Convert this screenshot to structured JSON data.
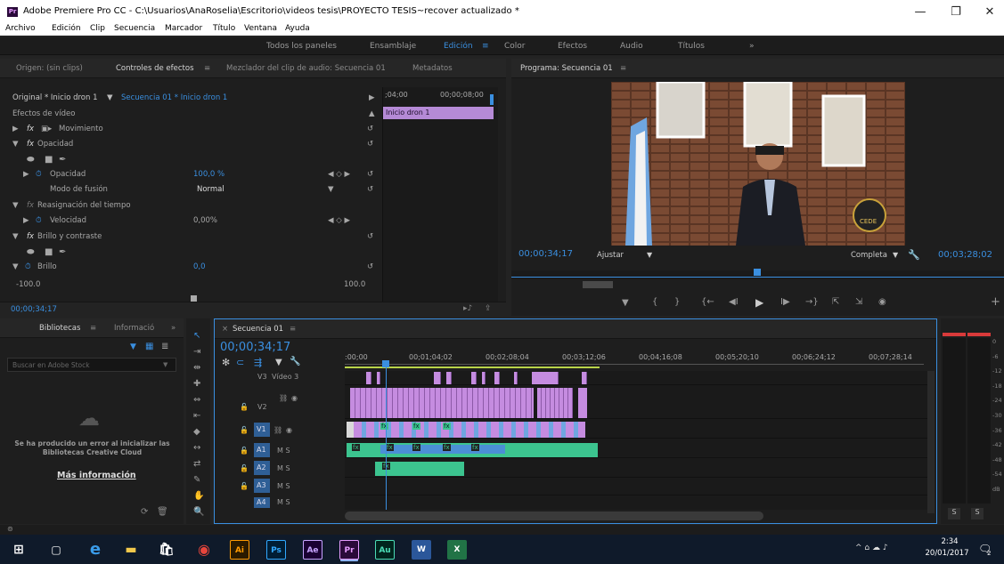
{
  "window": {
    "title": "Adobe Premiere Pro CC - C:\\Usuarios\\AnaRoselia\\Escritorio\\videos tesis\\PROYECTO TESIS~recover actualizado *",
    "app_icon": "Pr",
    "minimize": "—",
    "restore": "❐",
    "close": "✕"
  },
  "menu": [
    "Archivo",
    "Edición",
    "Clip",
    "Secuencia",
    "Marcador",
    "Título",
    "Ventana",
    "Ayuda"
  ],
  "workspaces": {
    "items": [
      "Todos los paneles",
      "Ensamblaje",
      "Edición",
      "Color",
      "Efectos",
      "Audio",
      "Títulos"
    ],
    "active": "Edición",
    "menu_glyph": "≡",
    "more": "»"
  },
  "source_panel": {
    "tabs": [
      "Origen: (sin clips)",
      "Controles de efectos",
      "Mezclador del clip de audio: Secuencia 01",
      "Metadatos"
    ],
    "menu_glyph": "≡",
    "clip_master": "Original * Inicio dron 1",
    "clip_sequence": "Secuencia 01 * Inicio dron 1",
    "ruler_start": ";04;00",
    "ruler_end": "00;00;08;00",
    "clip_bar": "Inicio dron 1",
    "section_video": "Efectos de vídeo",
    "fx_motion": "Movimiento",
    "fx_opacity": "Opacidad",
    "param_opacity": "Opacidad",
    "param_opacity_value": "100,0 %",
    "blend_label": "Modo de fusión",
    "blend_value": "Normal",
    "fx_timeremap": "Reasignación del tiempo",
    "param_speed": "Velocidad",
    "param_speed_value": "0,00%",
    "fx_brightness": "Brillo y contraste",
    "param_brightness": "Brillo",
    "param_brightness_value": "0,0",
    "range_min": "-100.0",
    "range_max": "100.0",
    "timecode": "00;00;34;17",
    "keyframe_nav": "◀ ◇ ▶",
    "fx_glyph": "fx"
  },
  "program_panel": {
    "title": "Programa: Secuencia 01",
    "menu_glyph": "≡",
    "timecode": "00;00;34;17",
    "fit": "Ajustar",
    "quality": "Completa",
    "duration": "00;03;28;02",
    "transport": [
      "▼",
      "{",
      "}",
      "{←",
      "◀I",
      "▶",
      "I▶",
      "→}",
      "⇱",
      "⇲",
      "◉"
    ],
    "add": "+",
    "seal_text": "CEDE"
  },
  "library_panel": {
    "tabs": [
      "Bibliotecas",
      "Informació"
    ],
    "menu_glyph": "≡",
    "more": "»",
    "search_placeholder": "Buscar en Adobe Stock",
    "error": "Se ha producido un error al inicializar las Bibliotecas Creative Cloud",
    "link": "Más información"
  },
  "tools": [
    "↖",
    "⇥",
    "⇹",
    "✚",
    "⇔",
    "⇤",
    "◆",
    "↔",
    "⇄",
    "✎",
    "✋",
    "🔍"
  ],
  "timeline": {
    "tab": "Secuencia 01",
    "close": "×",
    "menu_glyph": "≡",
    "timecode": "00;00;34;17",
    "ruler": [
      ":00;00",
      "00;01;04;02",
      "00;02;08;04",
      "00;03;12;06",
      "00;04;16;08",
      "00;05;20;10",
      "00;06;24;12",
      "00;07;28;14"
    ],
    "tracks": [
      {
        "name": "V3",
        "label": "Vídeo 3"
      },
      {
        "name": "V2",
        "label": ""
      },
      {
        "name": "V1",
        "label": ""
      },
      {
        "name": "A1",
        "label": "M S"
      },
      {
        "name": "A2",
        "label": "M S"
      },
      {
        "name": "A3",
        "label": "M S"
      },
      {
        "name": "A4",
        "label": "M S"
      }
    ],
    "fx_badge": "fx"
  },
  "audio_meter": {
    "scale": [
      "0",
      "-6",
      "-12",
      "-18",
      "-24",
      "-30",
      "-36",
      "-42",
      "-48",
      "-54",
      "dB"
    ],
    "solo": [
      "S",
      "S"
    ]
  },
  "taskbar": {
    "apps": [
      "⊞",
      "▢",
      "e",
      "▬",
      "🛍",
      "◉",
      "Ai",
      "Ps",
      "Ae",
      "Pr",
      "Au",
      "W",
      "X"
    ],
    "time": "2:34",
    "date": "20/01/2017",
    "tray": "^ ⌂ ☁ ♪",
    "notifications": "2"
  },
  "colors": {
    "accent_blue": "#3a8fe0",
    "clip_violet": "#c58ce0",
    "audio_green": "#3cc48f"
  }
}
